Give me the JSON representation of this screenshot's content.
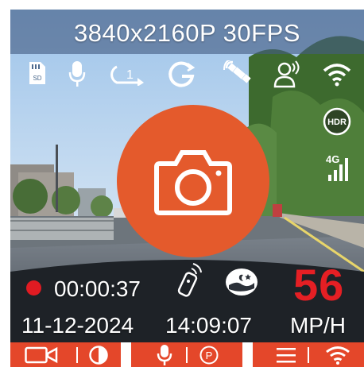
{
  "header": {
    "resolution": "3840x2160P 30FPS"
  },
  "status_icons": [
    "sd-card-icon",
    "microphone-icon",
    "loop-recording-1min-icon",
    "g-sensor-icon",
    "gps-satellite-icon",
    "parking-monitor-person-icon",
    "wifi-icon",
    "hdr-icon",
    "4g-signal-icon"
  ],
  "hdr_label": "HDR",
  "network_label": "4G",
  "recording": {
    "elapsed": "00:00:37"
  },
  "speed": {
    "value": "56",
    "unit": "MP/H"
  },
  "datetime": {
    "date": "11-12-2024",
    "time": "14:09:07"
  },
  "bottom_menu": [
    {
      "icon": "video-camera-icon"
    },
    {
      "icon": "contrast-icon"
    },
    {
      "icon": "microphone-icon"
    },
    {
      "icon": "parking-icon"
    },
    {
      "icon": "menu-icon"
    },
    {
      "icon": "wifi-icon"
    }
  ],
  "colors": {
    "accent": "#e45a2c",
    "record": "#e01b22",
    "speed": "#e51f24",
    "bar": "#e4472a",
    "header": "#445c82"
  }
}
